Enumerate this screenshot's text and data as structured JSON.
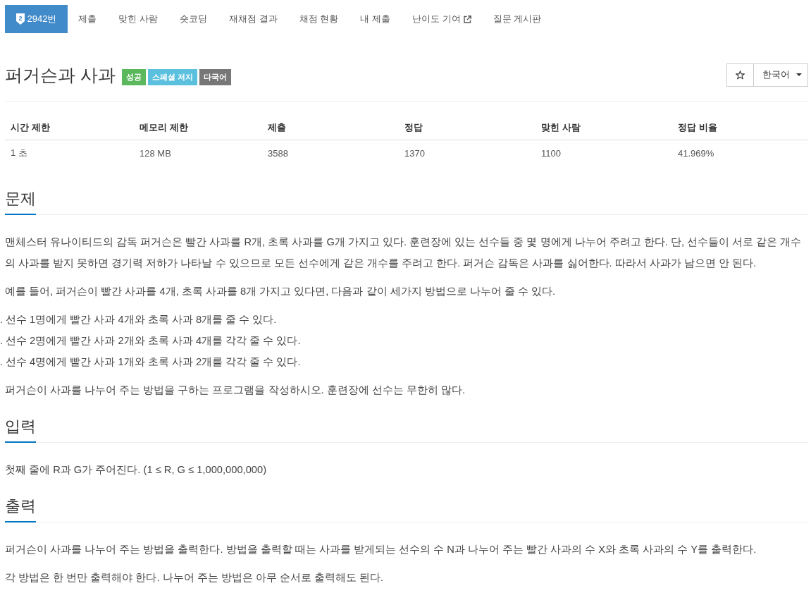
{
  "nav": {
    "tabs": [
      {
        "label": "2942번",
        "selected": true,
        "tier_badge": "2",
        "external": false
      },
      {
        "label": "제출",
        "selected": false,
        "external": false
      },
      {
        "label": "맞힌 사람",
        "selected": false,
        "external": false
      },
      {
        "label": "숏코딩",
        "selected": false,
        "external": false
      },
      {
        "label": "재채점 결과",
        "selected": false,
        "external": false
      },
      {
        "label": "채점 현황",
        "selected": false,
        "external": false
      },
      {
        "label": "내 제출",
        "selected": false,
        "external": false
      },
      {
        "label": "난이도 기여",
        "selected": false,
        "external": true
      },
      {
        "label": "질문 게시판",
        "selected": false,
        "external": false
      }
    ]
  },
  "problem": {
    "title": "퍼거슨과 사과",
    "labels": [
      {
        "text": "성공",
        "color": "#5cb85c"
      },
      {
        "text": "스페셜 저지",
        "color": "#5bc0de"
      },
      {
        "text": "다국어",
        "color": "#777777"
      }
    ],
    "language": "한국어"
  },
  "info_table": {
    "columns": [
      "시간 제한",
      "메모리 제한",
      "제출",
      "정답",
      "맞힌 사람",
      "정답 비율"
    ],
    "rows": [
      [
        "1 초",
        "128 MB",
        "3588",
        "1370",
        "1100",
        "41.969%"
      ]
    ]
  },
  "sections": [
    {
      "heading": "문제",
      "blocks": [
        {
          "kind": "paragraph",
          "text": "맨체스터 유나이티드의 감독 퍼거슨은 빨간 사과를 R개, 초록 사과를 G개 가지고 있다. 훈련장에 있는 선수들 중 몇 명에게 나누어 주려고 한다. 단, 선수들이 서로 같은 개수의 사과를 받지 못하면 경기력 저하가 나타날 수 있으므로 모든 선수에게 같은 개수를 주려고 한다. 퍼거슨 감독은 사과를 싫어한다. 따라서 사과가 남으면 안 된다."
        },
        {
          "kind": "paragraph",
          "text": "예를 들어, 퍼거슨이 빨간 사과를 4개, 초록 사과를 8개 가지고 있다면, 다음과 같이 세가지 방법으로 나누어 줄 수 있다."
        },
        {
          "kind": "list",
          "items": [
            {
              "marker": ".",
              "text": "선수 1명에게 빨간 사과 4개와 초록 사과 8개를 줄 수 있다."
            },
            {
              "marker": ".",
              "text": "선수 2명에게 빨간 사과 2개와 초록 사과 4개를 각각 줄 수 있다."
            },
            {
              "marker": ".",
              "text": "선수 4명에게 빨간 사과 1개와 초록 사과 2개를 각각 줄 수 있다."
            }
          ]
        },
        {
          "kind": "paragraph",
          "text": "퍼거슨이 사과를 나누어 주는 방법을 구하는 프로그램을 작성하시오. 훈련장에 선수는 무한히 많다."
        }
      ]
    },
    {
      "heading": "입력",
      "blocks": [
        {
          "kind": "paragraph",
          "text": "첫째 줄에 R과 G가 주어진다. (1 ≤ R, G ≤ 1,000,000,000)"
        }
      ]
    },
    {
      "heading": "출력",
      "blocks": [
        {
          "kind": "paragraph",
          "text": "퍼거슨이 사과를 나누어 주는 방법을 출력한다. 방법을 출력할 때는 사과를 받게되는 선수의 수 N과 나누어 주는 빨간 사과의 수 X와 초록 사과의 수 Y를 출력한다."
        },
        {
          "kind": "paragraph",
          "text": "각 방법은 한 번만 출력해야 한다. 나누어 주는 방법은 아무 순서로 출력해도 된다."
        }
      ]
    }
  ]
}
